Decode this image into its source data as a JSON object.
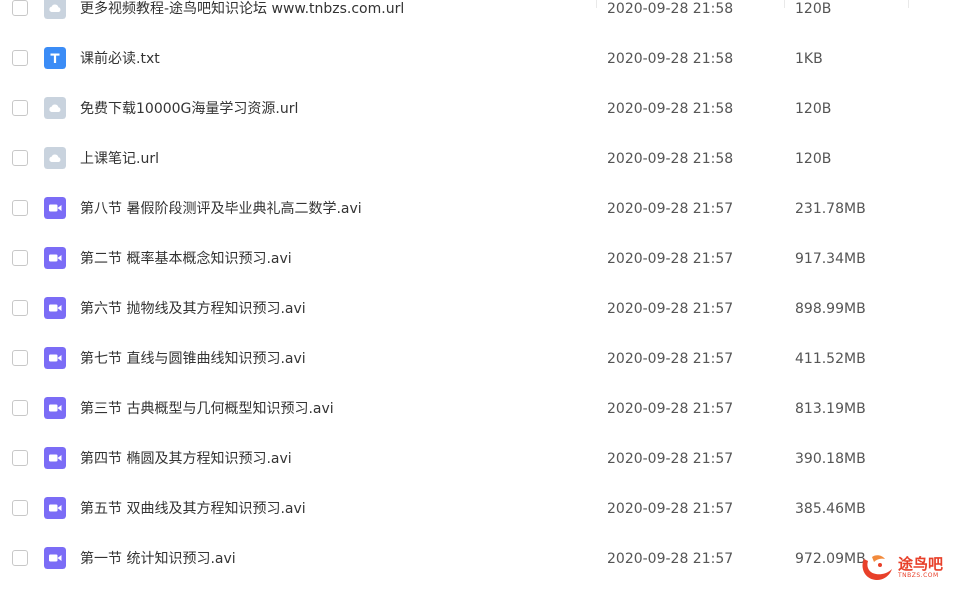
{
  "files": [
    {
      "name": "更多视频教程-途鸟吧知识论坛 www.tnbzs.com.url",
      "date": "2020-09-28 21:58",
      "size": "120B",
      "type": "url",
      "icon": "cloud-link-icon"
    },
    {
      "name": "课前必读.txt",
      "date": "2020-09-28 21:58",
      "size": "1KB",
      "type": "txt",
      "icon": "text-file-icon"
    },
    {
      "name": "免费下载10000G海量学习资源.url",
      "date": "2020-09-28 21:58",
      "size": "120B",
      "type": "url",
      "icon": "cloud-link-icon"
    },
    {
      "name": "上课笔记.url",
      "date": "2020-09-28 21:58",
      "size": "120B",
      "type": "url",
      "icon": "cloud-link-icon"
    },
    {
      "name": "第八节 暑假阶段测评及毕业典礼高二数学.avi",
      "date": "2020-09-28 21:57",
      "size": "231.78MB",
      "type": "video",
      "icon": "video-file-icon"
    },
    {
      "name": "第二节 概率基本概念知识预习.avi",
      "date": "2020-09-28 21:57",
      "size": "917.34MB",
      "type": "video",
      "icon": "video-file-icon"
    },
    {
      "name": "第六节 抛物线及其方程知识预习.avi",
      "date": "2020-09-28 21:57",
      "size": "898.99MB",
      "type": "video",
      "icon": "video-file-icon"
    },
    {
      "name": "第七节 直线与圆锥曲线知识预习.avi",
      "date": "2020-09-28 21:57",
      "size": "411.52MB",
      "type": "video",
      "icon": "video-file-icon"
    },
    {
      "name": "第三节 古典概型与几何概型知识预习.avi",
      "date": "2020-09-28 21:57",
      "size": "813.19MB",
      "type": "video",
      "icon": "video-file-icon"
    },
    {
      "name": "第四节 椭圆及其方程知识预习.avi",
      "date": "2020-09-28 21:57",
      "size": "390.18MB",
      "type": "video",
      "icon": "video-file-icon"
    },
    {
      "name": "第五节 双曲线及其方程知识预习.avi",
      "date": "2020-09-28 21:57",
      "size": "385.46MB",
      "type": "video",
      "icon": "video-file-icon"
    },
    {
      "name": "第一节 统计知识预习.avi",
      "date": "2020-09-28 21:57",
      "size": "972.09MB",
      "type": "video",
      "icon": "video-file-icon"
    }
  ],
  "watermark": {
    "text": "途鸟吧",
    "subtext": "TNBZS.COM",
    "color": "#e8402a"
  },
  "colors": {
    "video_icon": "#7b6cf6",
    "txt_icon": "#3b8cf6",
    "url_icon": "#c9d3de"
  }
}
